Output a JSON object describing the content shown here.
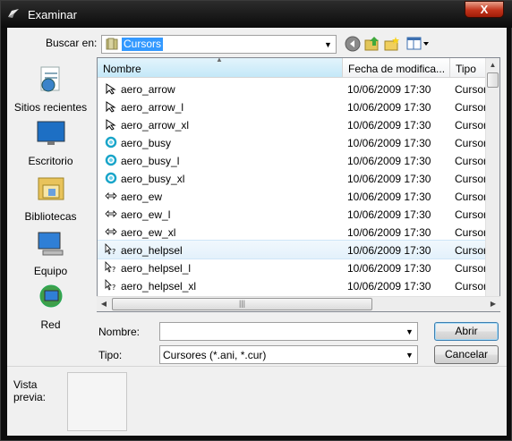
{
  "window": {
    "title": "Examinar",
    "close_label": "X"
  },
  "toolbar": {
    "lookin_label": "Buscar en:",
    "lookin_value": "Cursors"
  },
  "places": [
    {
      "label": "Sitios recientes",
      "icon": "recent-places-icon"
    },
    {
      "label": "Escritorio",
      "icon": "desktop-icon"
    },
    {
      "label": "Bibliotecas",
      "icon": "libraries-icon"
    },
    {
      "label": "Equipo",
      "icon": "computer-icon"
    },
    {
      "label": "Red",
      "icon": "network-icon"
    }
  ],
  "list": {
    "columns": [
      "Nombre",
      "Fecha de modifica...",
      "Tipo"
    ],
    "selected_index": 9,
    "rows": [
      {
        "name": "aero_arrow",
        "date": "10/06/2009 17:30",
        "type": "Cursor",
        "icon": "arrow"
      },
      {
        "name": "aero_arrow_l",
        "date": "10/06/2009 17:30",
        "type": "Cursor",
        "icon": "arrow"
      },
      {
        "name": "aero_arrow_xl",
        "date": "10/06/2009 17:30",
        "type": "Cursor",
        "icon": "arrow"
      },
      {
        "name": "aero_busy",
        "date": "10/06/2009 17:30",
        "type": "Cursor",
        "icon": "busy"
      },
      {
        "name": "aero_busy_l",
        "date": "10/06/2009 17:30",
        "type": "Cursor",
        "icon": "busy"
      },
      {
        "name": "aero_busy_xl",
        "date": "10/06/2009 17:30",
        "type": "Cursor",
        "icon": "busy"
      },
      {
        "name": "aero_ew",
        "date": "10/06/2009 17:30",
        "type": "Cursor",
        "icon": "ew"
      },
      {
        "name": "aero_ew_l",
        "date": "10/06/2009 17:30",
        "type": "Cursor",
        "icon": "ew"
      },
      {
        "name": "aero_ew_xl",
        "date": "10/06/2009 17:30",
        "type": "Cursor",
        "icon": "ew"
      },
      {
        "name": "aero_helpsel",
        "date": "10/06/2009 17:30",
        "type": "Cursor",
        "icon": "help"
      },
      {
        "name": "aero_helpsel_l",
        "date": "10/06/2009 17:30",
        "type": "Cursor",
        "icon": "help"
      },
      {
        "name": "aero_helpsel_xl",
        "date": "10/06/2009 17:30",
        "type": "Cursor",
        "icon": "help"
      }
    ]
  },
  "form": {
    "name_label": "Nombre:",
    "name_value": "",
    "type_label": "Tipo:",
    "type_value": "Cursores (*.ani, *.cur)",
    "open_label": "Abrir",
    "cancel_label": "Cancelar"
  },
  "preview": {
    "label_line1": "Vista",
    "label_line2": "previa:"
  },
  "colors": {
    "selection": "#3399ff",
    "close": "#c2331b",
    "window_frame": "#0e0e0e",
    "dialog_bg": "#f0f0f0"
  }
}
